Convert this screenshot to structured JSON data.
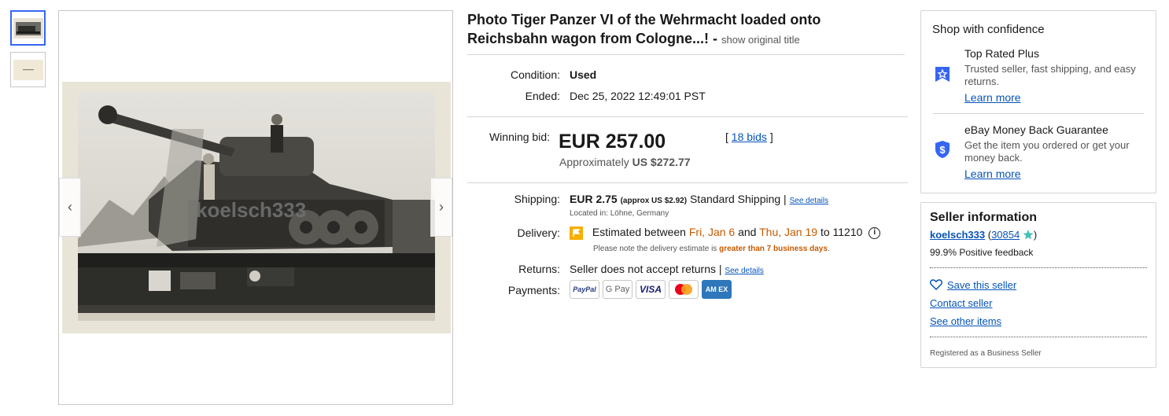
{
  "gallery": {
    "watermark": "koelsch333",
    "prev_arrow": "‹",
    "next_arrow": "›"
  },
  "listing": {
    "title": "Photo Tiger Panzer VI of the Wehrmacht loaded onto Reichsbahn wagon from Cologne...! -",
    "show_original": "show original title",
    "condition_label": "Condition:",
    "condition_value": "Used",
    "ended_label": "Ended:",
    "ended_value": "Dec 25, 2022 12:49:01 PST",
    "winning_bid_label": "Winning bid:",
    "winning_bid_value": "EUR 257.00",
    "approx_prefix": "Approximately",
    "approx_value": "US $272.77",
    "bids_open": "[",
    "bids_link": "18 bids",
    "bids_close": "]",
    "shipping_label": "Shipping:",
    "shipping_price": "EUR 2.75",
    "shipping_approx": "(approx US $2.92)",
    "shipping_method": "Standard Shipping |",
    "see_details": "See details",
    "located_in": "Located in: Löhne, Germany",
    "delivery_label": "Delivery:",
    "delivery_prefix": "Estimated between",
    "delivery_from": "Fri, Jan 6",
    "delivery_and": "and",
    "delivery_to": "Thu, Jan 19",
    "delivery_zip": "to 11210",
    "delivery_note_prefix": "Please note the delivery estimate is",
    "delivery_note_highlight": "greater than 7 business days",
    "delivery_note_suffix": ".",
    "returns_label": "Returns:",
    "returns_value": "Seller does not accept returns |",
    "returns_see_details": "See details",
    "payments_label": "Payments:",
    "payment_methods": [
      "PayPal",
      "G Pay",
      "VISA",
      "",
      "AM EX"
    ]
  },
  "confidence": {
    "title": "Shop with confidence",
    "top_rated_head": "Top Rated Plus",
    "top_rated_desc": "Trusted seller, fast shipping, and easy returns.",
    "top_rated_link": "Learn more",
    "mbg_head": "eBay Money Back Guarantee",
    "mbg_desc": "Get the item you ordered or get your money back.",
    "mbg_link": "Learn more"
  },
  "seller": {
    "title": "Seller information",
    "name": "koelsch333",
    "feedback_open": "(",
    "feedback_score": "30854",
    "feedback_close": ")",
    "positive": "99.9% Positive feedback",
    "save": "Save this seller",
    "contact": "Contact seller",
    "other_items": "See other items",
    "registered": "Registered as a Business Seller"
  },
  "colors": {
    "link": "#0654ba",
    "accent_blue": "#3665f3",
    "orange": "#c55a00",
    "flag": "#f5af02"
  }
}
